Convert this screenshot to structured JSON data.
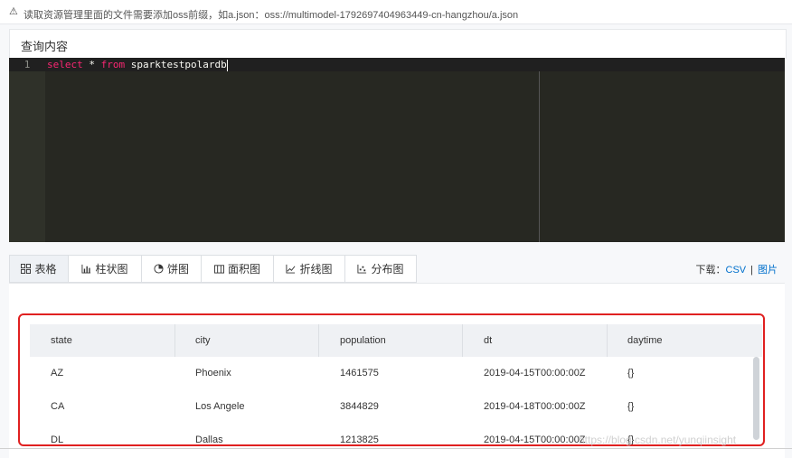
{
  "notice": {
    "icon": "warning-icon",
    "text": "读取资源管理里面的文件需要添加oss前缀，如a.json：oss://multimodel-1792697404963449-cn-hangzhou/a.json"
  },
  "query": {
    "title": "查询内容",
    "line_number": "1",
    "code": {
      "kw1": "select",
      "mid": " * ",
      "kw2": "from",
      "rest": " sparktestpolardb"
    }
  },
  "tabs": [
    {
      "label": "表格",
      "icon": "table-icon",
      "active": true
    },
    {
      "label": "柱状图",
      "icon": "bar-chart-icon"
    },
    {
      "label": "饼图",
      "icon": "pie-chart-icon"
    },
    {
      "label": "面积图",
      "icon": "area-chart-icon"
    },
    {
      "label": "折线图",
      "icon": "line-chart-icon"
    },
    {
      "label": "分布图",
      "icon": "scatter-chart-icon"
    }
  ],
  "download": {
    "label": "下载：",
    "csv": "CSV",
    "separator": "|",
    "image": "图片"
  },
  "table": {
    "columns": [
      "state",
      "city",
      "population",
      "dt",
      "daytime"
    ],
    "rows": [
      [
        "AZ",
        "Phoenix",
        "1461575",
        "2019-04-15T00:00:00Z",
        "{}"
      ],
      [
        "CA",
        "Los Angele",
        "3844829",
        "2019-04-18T00:00:00Z",
        "{}"
      ],
      [
        "DL",
        "Dallas",
        "1213825",
        "2019-04-15T00:00:00Z",
        "{}"
      ]
    ]
  },
  "watermark": "https://blog.csdn.net/yunqiinsight",
  "colors": {
    "highlight": "#e02020",
    "link": "#0070cc",
    "editor_bg": "#272822",
    "keyword": "#f92672"
  }
}
